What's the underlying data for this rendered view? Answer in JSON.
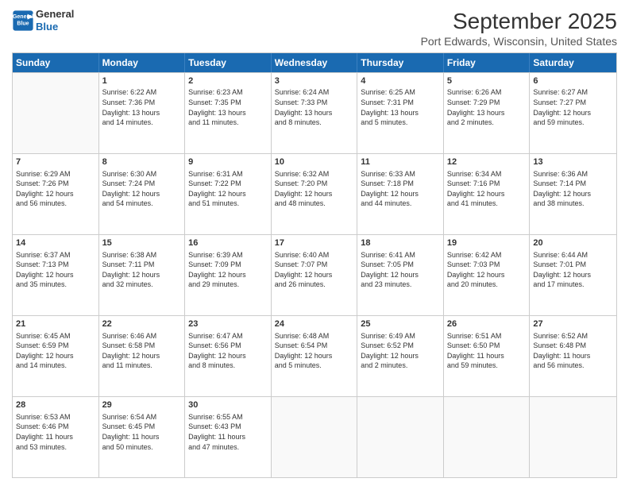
{
  "header": {
    "logo_line1": "General",
    "logo_line2": "Blue",
    "title": "September 2025",
    "subtitle": "Port Edwards, Wisconsin, United States"
  },
  "calendar": {
    "days": [
      "Sunday",
      "Monday",
      "Tuesday",
      "Wednesday",
      "Thursday",
      "Friday",
      "Saturday"
    ],
    "rows": [
      [
        {
          "day": "",
          "info": ""
        },
        {
          "day": "1",
          "info": "Sunrise: 6:22 AM\nSunset: 7:36 PM\nDaylight: 13 hours\nand 14 minutes."
        },
        {
          "day": "2",
          "info": "Sunrise: 6:23 AM\nSunset: 7:35 PM\nDaylight: 13 hours\nand 11 minutes."
        },
        {
          "day": "3",
          "info": "Sunrise: 6:24 AM\nSunset: 7:33 PM\nDaylight: 13 hours\nand 8 minutes."
        },
        {
          "day": "4",
          "info": "Sunrise: 6:25 AM\nSunset: 7:31 PM\nDaylight: 13 hours\nand 5 minutes."
        },
        {
          "day": "5",
          "info": "Sunrise: 6:26 AM\nSunset: 7:29 PM\nDaylight: 13 hours\nand 2 minutes."
        },
        {
          "day": "6",
          "info": "Sunrise: 6:27 AM\nSunset: 7:27 PM\nDaylight: 12 hours\nand 59 minutes."
        }
      ],
      [
        {
          "day": "7",
          "info": "Sunrise: 6:29 AM\nSunset: 7:26 PM\nDaylight: 12 hours\nand 56 minutes."
        },
        {
          "day": "8",
          "info": "Sunrise: 6:30 AM\nSunset: 7:24 PM\nDaylight: 12 hours\nand 54 minutes."
        },
        {
          "day": "9",
          "info": "Sunrise: 6:31 AM\nSunset: 7:22 PM\nDaylight: 12 hours\nand 51 minutes."
        },
        {
          "day": "10",
          "info": "Sunrise: 6:32 AM\nSunset: 7:20 PM\nDaylight: 12 hours\nand 48 minutes."
        },
        {
          "day": "11",
          "info": "Sunrise: 6:33 AM\nSunset: 7:18 PM\nDaylight: 12 hours\nand 44 minutes."
        },
        {
          "day": "12",
          "info": "Sunrise: 6:34 AM\nSunset: 7:16 PM\nDaylight: 12 hours\nand 41 minutes."
        },
        {
          "day": "13",
          "info": "Sunrise: 6:36 AM\nSunset: 7:14 PM\nDaylight: 12 hours\nand 38 minutes."
        }
      ],
      [
        {
          "day": "14",
          "info": "Sunrise: 6:37 AM\nSunset: 7:13 PM\nDaylight: 12 hours\nand 35 minutes."
        },
        {
          "day": "15",
          "info": "Sunrise: 6:38 AM\nSunset: 7:11 PM\nDaylight: 12 hours\nand 32 minutes."
        },
        {
          "day": "16",
          "info": "Sunrise: 6:39 AM\nSunset: 7:09 PM\nDaylight: 12 hours\nand 29 minutes."
        },
        {
          "day": "17",
          "info": "Sunrise: 6:40 AM\nSunset: 7:07 PM\nDaylight: 12 hours\nand 26 minutes."
        },
        {
          "day": "18",
          "info": "Sunrise: 6:41 AM\nSunset: 7:05 PM\nDaylight: 12 hours\nand 23 minutes."
        },
        {
          "day": "19",
          "info": "Sunrise: 6:42 AM\nSunset: 7:03 PM\nDaylight: 12 hours\nand 20 minutes."
        },
        {
          "day": "20",
          "info": "Sunrise: 6:44 AM\nSunset: 7:01 PM\nDaylight: 12 hours\nand 17 minutes."
        }
      ],
      [
        {
          "day": "21",
          "info": "Sunrise: 6:45 AM\nSunset: 6:59 PM\nDaylight: 12 hours\nand 14 minutes."
        },
        {
          "day": "22",
          "info": "Sunrise: 6:46 AM\nSunset: 6:58 PM\nDaylight: 12 hours\nand 11 minutes."
        },
        {
          "day": "23",
          "info": "Sunrise: 6:47 AM\nSunset: 6:56 PM\nDaylight: 12 hours\nand 8 minutes."
        },
        {
          "day": "24",
          "info": "Sunrise: 6:48 AM\nSunset: 6:54 PM\nDaylight: 12 hours\nand 5 minutes."
        },
        {
          "day": "25",
          "info": "Sunrise: 6:49 AM\nSunset: 6:52 PM\nDaylight: 12 hours\nand 2 minutes."
        },
        {
          "day": "26",
          "info": "Sunrise: 6:51 AM\nSunset: 6:50 PM\nDaylight: 11 hours\nand 59 minutes."
        },
        {
          "day": "27",
          "info": "Sunrise: 6:52 AM\nSunset: 6:48 PM\nDaylight: 11 hours\nand 56 minutes."
        }
      ],
      [
        {
          "day": "28",
          "info": "Sunrise: 6:53 AM\nSunset: 6:46 PM\nDaylight: 11 hours\nand 53 minutes."
        },
        {
          "day": "29",
          "info": "Sunrise: 6:54 AM\nSunset: 6:45 PM\nDaylight: 11 hours\nand 50 minutes."
        },
        {
          "day": "30",
          "info": "Sunrise: 6:55 AM\nSunset: 6:43 PM\nDaylight: 11 hours\nand 47 minutes."
        },
        {
          "day": "",
          "info": ""
        },
        {
          "day": "",
          "info": ""
        },
        {
          "day": "",
          "info": ""
        },
        {
          "day": "",
          "info": ""
        }
      ]
    ]
  }
}
